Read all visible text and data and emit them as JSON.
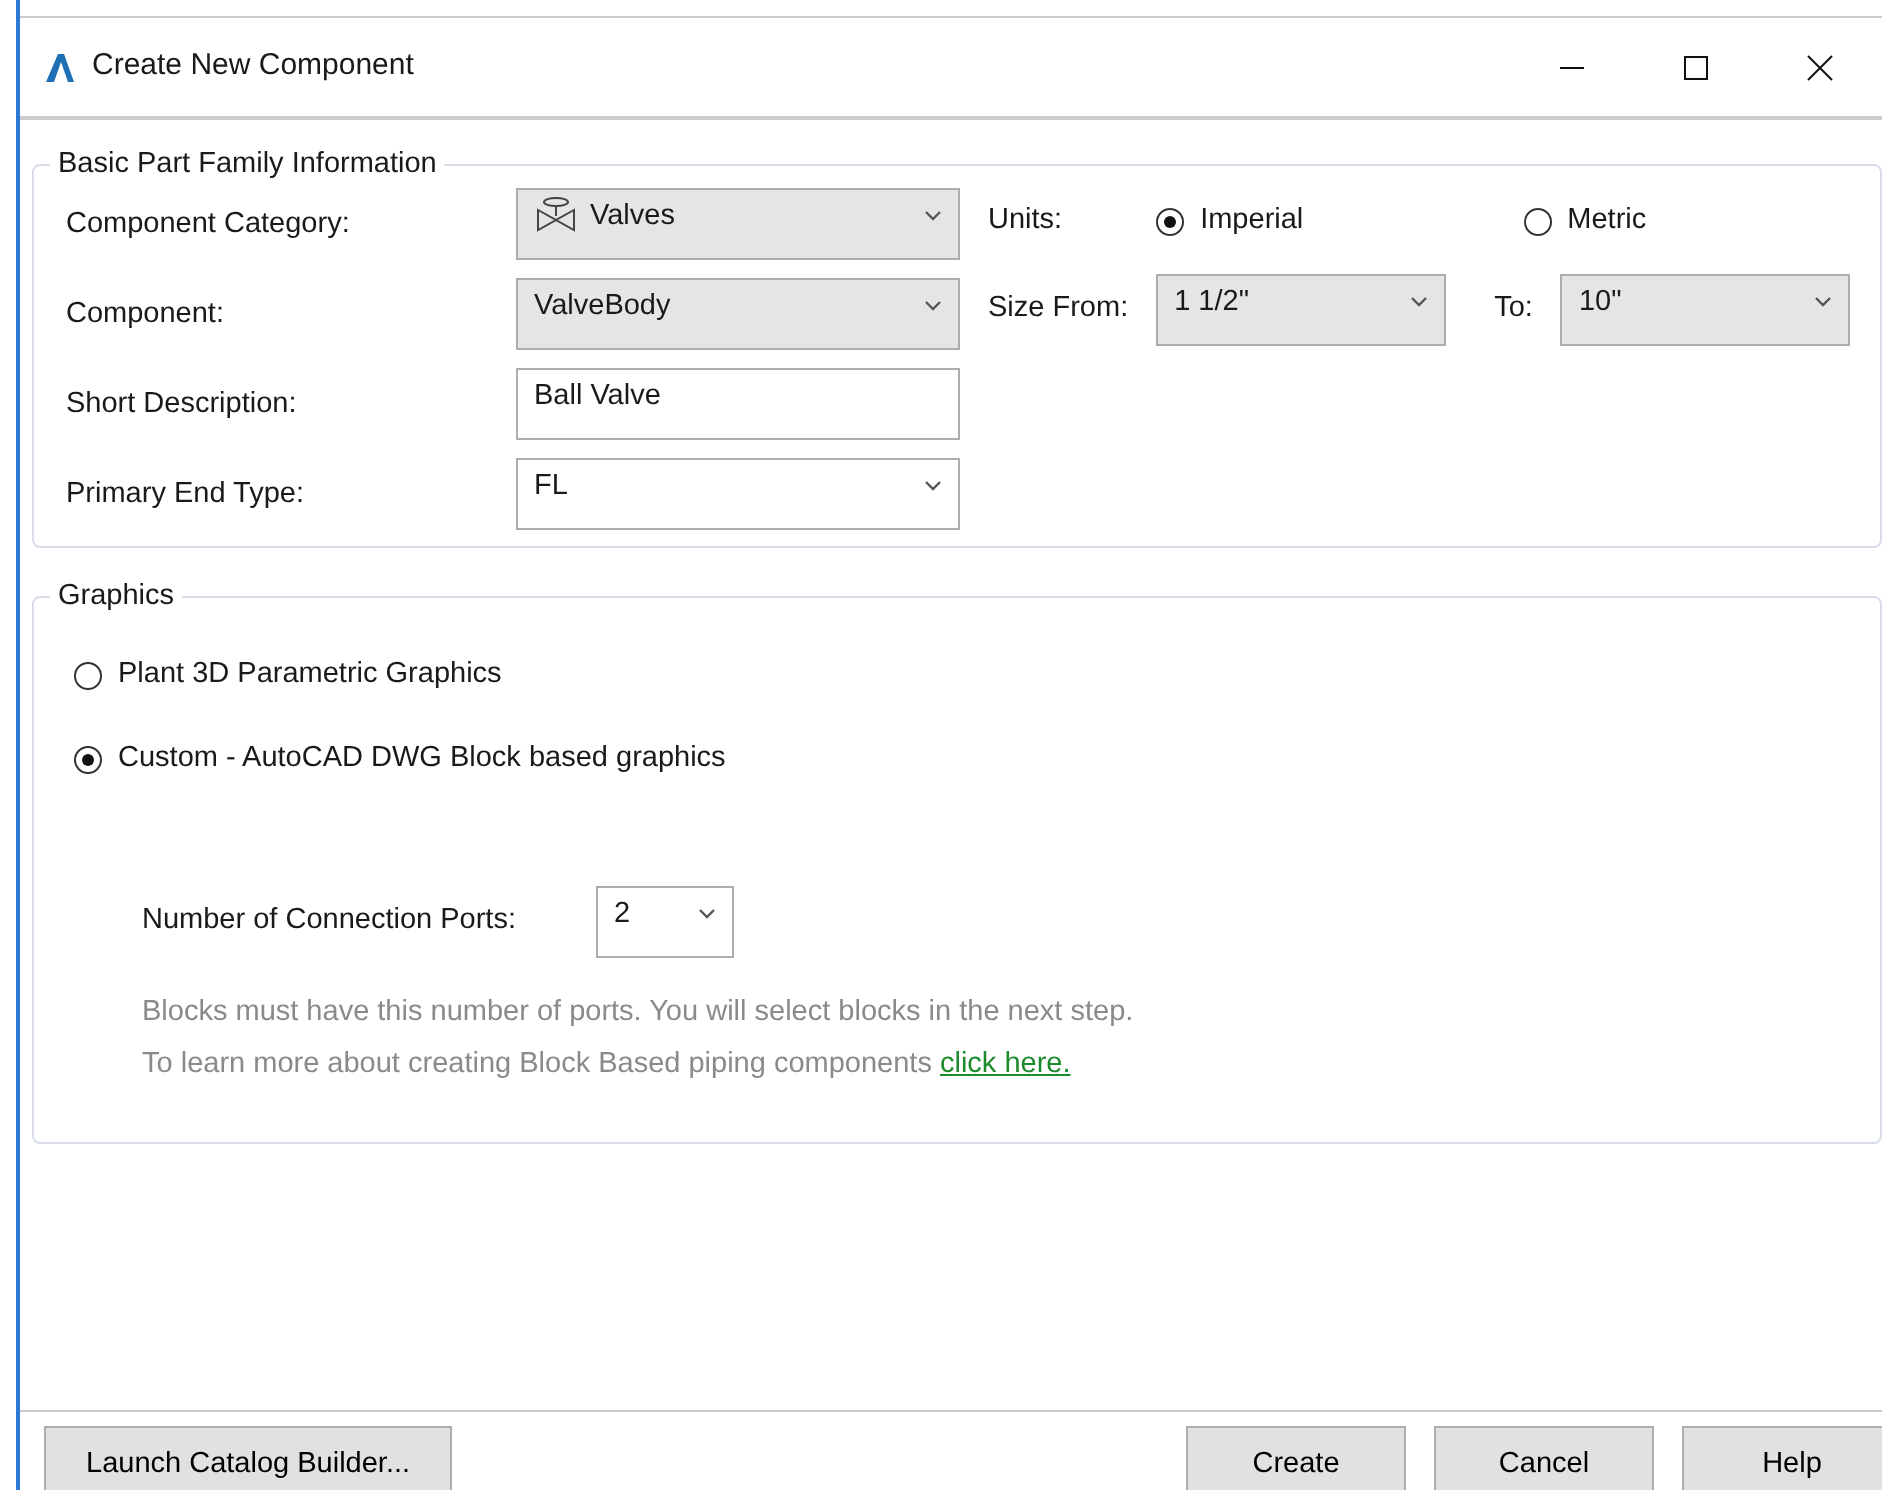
{
  "window": {
    "title": "Create New Component"
  },
  "basic_info": {
    "legend": "Basic Part Family Information",
    "fields": [
      {
        "label": "Component Category:",
        "kind": "dropdown",
        "value": "Valves"
      },
      {
        "label": "Component:",
        "kind": "dropdown",
        "value": "ValveBody"
      },
      {
        "label": "Short Description:",
        "kind": "text",
        "value": "Ball Valve"
      },
      {
        "label": "Primary End Type:",
        "kind": "editable-dropdown",
        "value": "FL"
      }
    ],
    "units": {
      "label": "Units:",
      "options": [
        {
          "label": "Imperial",
          "selected": true
        },
        {
          "label": "Metric",
          "selected": false
        }
      ]
    },
    "size": {
      "from_label": "Size From:",
      "from_value": "1 1/2\"",
      "to_label": "To:",
      "to_value": "10\""
    }
  },
  "graphics": {
    "legend": "Graphics",
    "options": [
      {
        "label": "Plant 3D Parametric Graphics",
        "selected": false
      },
      {
        "label": "Custom - AutoCAD DWG Block based graphics",
        "selected": true
      }
    ],
    "ports_label": "Number of Connection Ports:",
    "ports_value": "2",
    "note": "Blocks must have this number of ports. You will select blocks in the next step.",
    "learn_more": "To learn more about creating Block Based piping components",
    "link": "click here."
  },
  "footer": {
    "left_button": "Launch Catalog Builder...",
    "buttons": [
      "Create",
      "Cancel",
      "Help"
    ]
  }
}
